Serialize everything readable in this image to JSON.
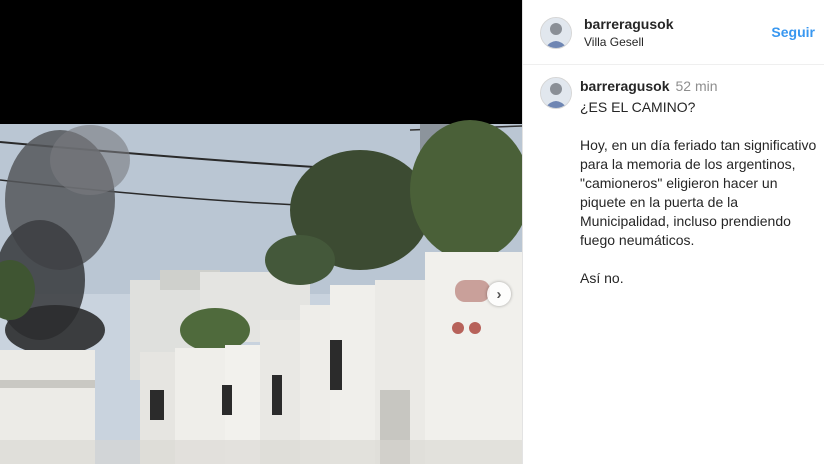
{
  "post": {
    "username": "barreragusok",
    "location": "Villa Gesell",
    "follow_label": "Seguir",
    "time": "52 min",
    "caption_lines": [
      "¿ES EL CAMINO?",
      "",
      "Hoy, en un día feriado tan significativo",
      "para la memoria de los argentinos,",
      "\"camioneros\" eligieron hacer un",
      "piquete en la puerta de la",
      "Municipalidad, incluso prendiendo",
      "fuego neumáticos.",
      "",
      "Así no."
    ]
  },
  "icons": {
    "next": "chevron-right-icon",
    "avatar": "user-avatar"
  },
  "colors": {
    "link": "#3897f0",
    "text": "#262626",
    "muted": "#8e8e8e"
  }
}
